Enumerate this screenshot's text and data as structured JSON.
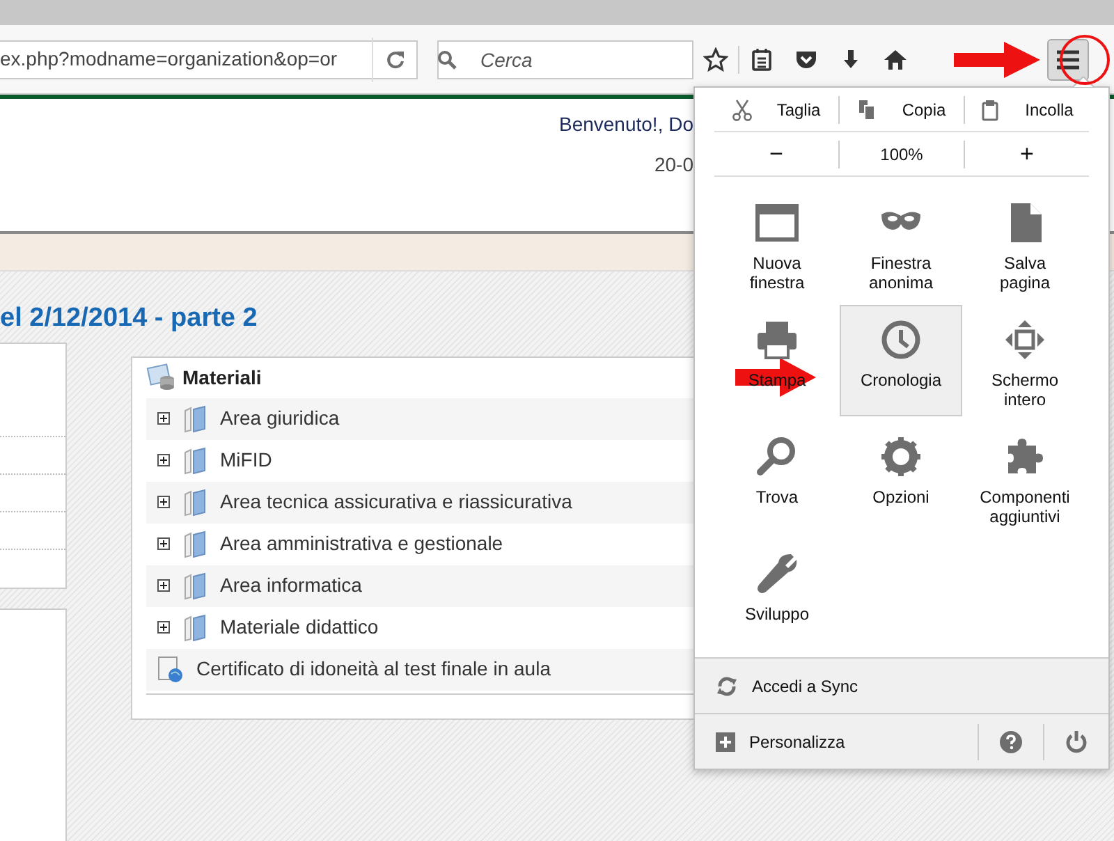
{
  "browser": {
    "url": "ex.php?modname=organization&op=or",
    "search_placeholder": "Cerca"
  },
  "header": {
    "welcome": "Benvenuto!, Do",
    "date": "20-0"
  },
  "page_title": "el 2/12/2014 - parte 2",
  "materials": {
    "title": "Materiali",
    "items": [
      {
        "label": "Area giuridica",
        "kind": "folder",
        "expanded": false
      },
      {
        "label": "MiFID",
        "kind": "folder",
        "expanded": false
      },
      {
        "label": "Area tecnica assicurativa e riassicurativa",
        "kind": "folder",
        "expanded": false
      },
      {
        "label": "Area amministrativa e gestionale",
        "kind": "folder",
        "expanded": false
      },
      {
        "label": "Area informatica",
        "kind": "folder",
        "expanded": false
      },
      {
        "label": "Materiale didattico",
        "kind": "folder",
        "expanded": false
      },
      {
        "label": "Certificato di idoneità al test finale in aula",
        "kind": "test"
      }
    ]
  },
  "menu": {
    "edit": [
      {
        "label": "Taglia",
        "kind": "cut"
      },
      {
        "label": "Copia",
        "kind": "copy"
      },
      {
        "label": "Incolla",
        "kind": "paste"
      }
    ],
    "zoom": {
      "minus": "−",
      "level": "100%",
      "plus": "+"
    },
    "items": [
      {
        "label": "Nuova finestra",
        "kind": "window",
        "hovered": false
      },
      {
        "label": "Finestra anonima",
        "kind": "mask",
        "hovered": false
      },
      {
        "label": "Salva pagina",
        "kind": "page",
        "hovered": false
      },
      {
        "label": "Stampa",
        "kind": "printer",
        "hovered": false
      },
      {
        "label": "Cronologia",
        "kind": "clock",
        "hovered": true
      },
      {
        "label": "Schermo intero",
        "kind": "fullscreen",
        "hovered": false
      },
      {
        "label": "Trova",
        "kind": "search",
        "hovered": false
      },
      {
        "label": "Opzioni",
        "kind": "gear",
        "hovered": false
      },
      {
        "label": "Componenti aggiuntivi",
        "kind": "puzzle",
        "hovered": false
      },
      {
        "label": "Sviluppo",
        "kind": "wrench",
        "hovered": false
      }
    ],
    "sync": "Accedi a Sync",
    "customize": "Personalizza"
  }
}
